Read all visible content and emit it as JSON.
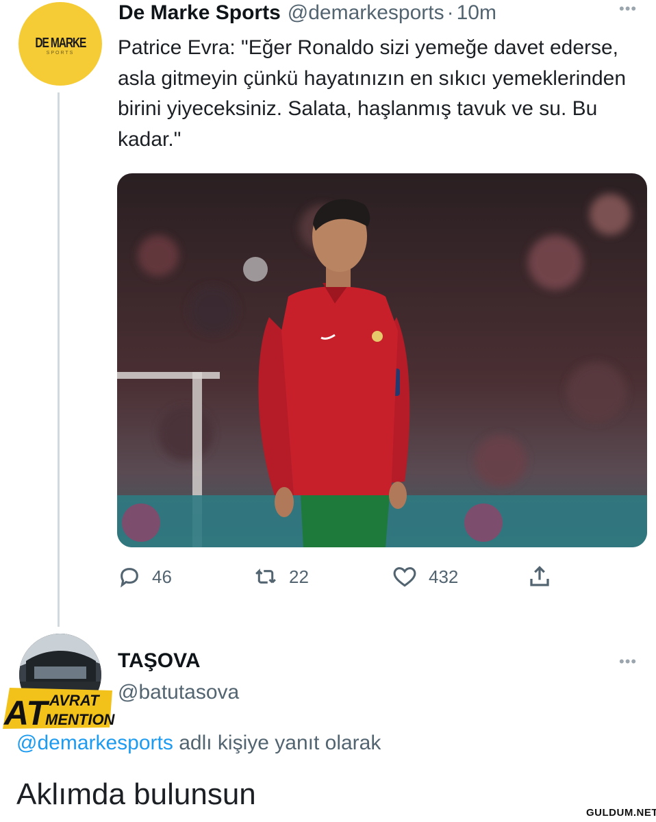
{
  "tweet": {
    "avatar_logo_main": "DE MARKE",
    "avatar_logo_sub": "SPORTS",
    "author_name": "De Marke Sports",
    "handle": "@demarkesports",
    "separator": "·",
    "time": "10m",
    "text": "Patrice Evra: \"Eğer Ronaldo sizi yemeğe davet ederse, asla gitmeyin çünkü hayatınızın en sıkıcı yemeklerinden birini yiyeceksiniz. Salata, haşlanmış tavuk ve su. Bu kadar.\"",
    "media_icon": "football-player-photo",
    "actions": {
      "reply_icon": "reply-icon",
      "reply_count": "46",
      "retweet_icon": "retweet-icon",
      "retweet_count": "22",
      "like_icon": "heart-icon",
      "like_count": "432",
      "share_icon": "share-icon"
    },
    "more_icon": "more-horizontal-icon"
  },
  "reply": {
    "author_name": "TAŞOVA",
    "handle": "@batutasova",
    "sticker_text_at": "AT",
    "sticker_text_top": "AVRAT",
    "sticker_text_bottom": "MENTION",
    "reply_to_mention": "@demarkesports",
    "reply_to_suffix": " adlı kişiye yanıt olarak",
    "text": "Aklımda bulunsun"
  },
  "watermark": "GULDUM.NET",
  "colors": {
    "accent": "#1d9bf0",
    "avatar_yellow": "#f5cc35",
    "secondary_text": "#536471",
    "jersey_red": "#c8202b",
    "shorts_green": "#1e7a3a"
  }
}
